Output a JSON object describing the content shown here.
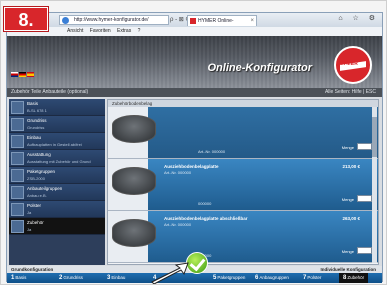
{
  "step_badge": "8.",
  "browser": {
    "address": "http://www.hymer-konfigurator.de/",
    "address_tools": "ρ - ⊠ ¢ ×",
    "tab_title": "HYMER Online-Konfigurator",
    "tab_close": "×",
    "window_controls": "⌂ ☆ ⚙",
    "menu": [
      "Ansicht",
      "Favoriten",
      "Extras",
      "?"
    ]
  },
  "app": {
    "title": "Online-Konfigurator",
    "logo_text": "HYMER",
    "subbar_left": "Zubehör Teile Anbauteile (optional)",
    "subbar_right": "Alle Seiten: Hilfe | ESC"
  },
  "sidebar": {
    "items": [
      {
        "l1": "Basis",
        "l2": "B-SL 678 1",
        "icon": "vehicle-icon"
      },
      {
        "l1": "Grundriss",
        "l2": "Grundriss",
        "icon": "floorplan-icon"
      },
      {
        "l1": "Einbau",
        "l2": "Aufbauplatten in Gestell ab/frei",
        "icon": "interior-icon"
      },
      {
        "l1": "Ausstattung",
        "l2": "Ausstattung mit Zubehör und Grund",
        "icon": "equipment-icon"
      },
      {
        "l1": "Paketgruppen",
        "l2": "ZSB-2000",
        "icon": "package-icon"
      },
      {
        "l1": "Anbauteilgruppen",
        "l2": "Anbau e.B.",
        "icon": "mount-icon"
      },
      {
        "l1": "Polster",
        "l2": "Ja",
        "icon": "upholstery-icon"
      },
      {
        "l1": "Zubehör",
        "l2": "Ja",
        "icon": "accessories-icon"
      }
    ]
  },
  "panel": {
    "header": "Zubehörbodenbelag",
    "products": [
      {
        "name": "",
        "art": "Art.-Nr. 000000",
        "art2": "000000",
        "price": "",
        "qty_label": "Menge"
      },
      {
        "name": "Ausziehbodenbelagplatte",
        "art": "Art.-Nr. 000000",
        "art2": "000000",
        "price": "213,00 €",
        "qty_label": "Menge"
      },
      {
        "name": "Ausziehbodenbelagplatte abschließbar",
        "art": "Art.-Nr. 000000",
        "art2": "000000",
        "price": "263,00 €",
        "qty_label": "Menge"
      }
    ]
  },
  "config": {
    "left_label": "Grundkonfiguration",
    "right_label": "Individuelle Konfiguration",
    "steps": [
      {
        "n": "1",
        "label": "Basis"
      },
      {
        "n": "2",
        "label": "Grundriss"
      },
      {
        "n": "3",
        "label": "Einbau"
      },
      {
        "n": "4",
        "label": ""
      },
      {
        "n": "5",
        "label": "Paketgruppen"
      },
      {
        "n": "6",
        "label": "Anbaugruppen"
      },
      {
        "n": "7",
        "label": "Polster"
      },
      {
        "n": "8",
        "label": "Zubehör"
      }
    ]
  },
  "colors": {
    "accent_red": "#d8262b",
    "nav_blue": "#1f6db0",
    "check_green": "#3c9b12"
  }
}
